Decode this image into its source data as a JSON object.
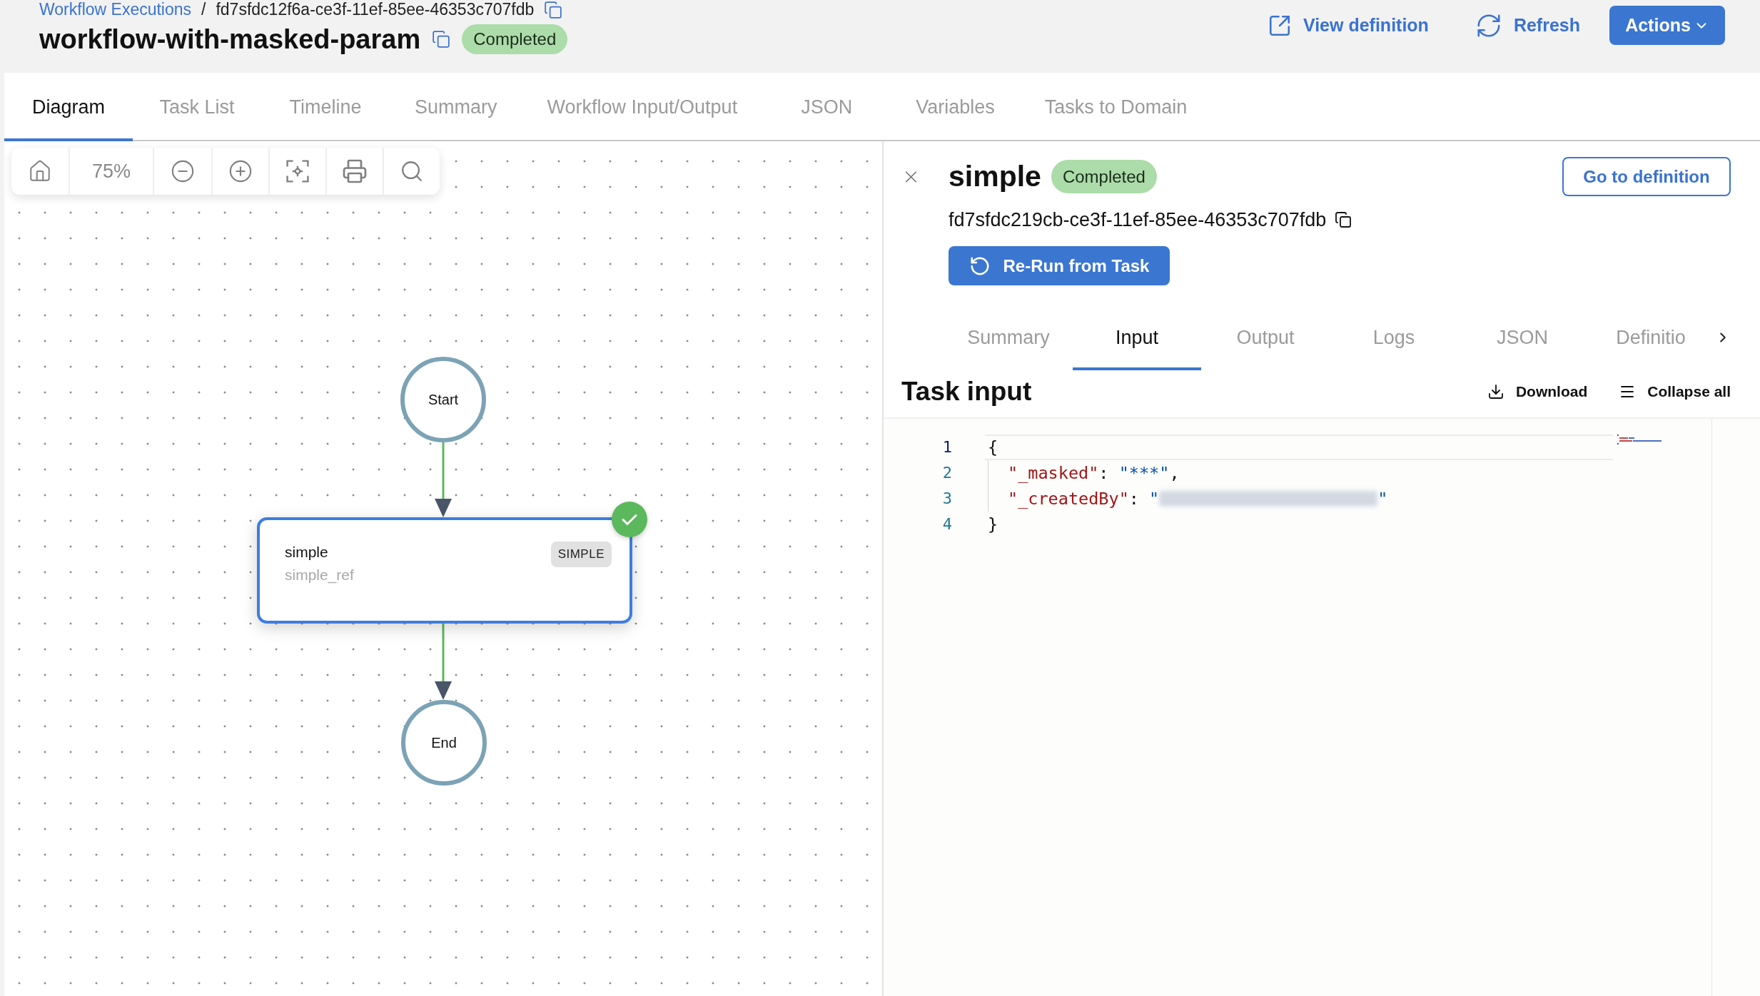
{
  "breadcrumb": {
    "link": "Workflow Executions",
    "separator": "/",
    "current": "fd7sfdc12f6a-ce3f-11ef-85ee-46353c707fdb"
  },
  "header": {
    "title": "workflow-with-masked-param",
    "status": "Completed",
    "view_definition": "View definition",
    "refresh": "Refresh",
    "actions": "Actions"
  },
  "tabs": [
    {
      "label": "Diagram",
      "selected": true
    },
    {
      "label": "Task List",
      "selected": false
    },
    {
      "label": "Timeline",
      "selected": false
    },
    {
      "label": "Summary",
      "selected": false
    },
    {
      "label": "Workflow Input/Output",
      "selected": false
    },
    {
      "label": "JSON",
      "selected": false
    },
    {
      "label": "Variables",
      "selected": false
    },
    {
      "label": "Tasks to Domain",
      "selected": false
    }
  ],
  "diagram": {
    "zoom": "75%",
    "nodes": [
      {
        "kind": "start",
        "label": "Start"
      },
      {
        "kind": "task",
        "name": "simple",
        "reference": "simple_ref",
        "type": "SIMPLE",
        "completed": true
      },
      {
        "kind": "end",
        "label": "End"
      }
    ],
    "edges": [
      {
        "executed": true
      },
      {
        "executed": true
      }
    ]
  },
  "task_panel": {
    "title": "simple",
    "status": "Completed",
    "go_to_definition": "Go to definition",
    "task_id": "fd7sfdc219cb-ce3f-11ef-85ee-46353c707fdb",
    "rerun": "Re-Run from Task",
    "tabs": [
      {
        "label": "Summary",
        "selected": false
      },
      {
        "label": "Input",
        "selected": true
      },
      {
        "label": "Output",
        "selected": false
      },
      {
        "label": "Logs",
        "selected": false
      },
      {
        "label": "JSON",
        "selected": false
      },
      {
        "label": "Definitio",
        "selected": false
      }
    ],
    "section_title": "Task input",
    "download": "Download",
    "collapse_all": "Collapse all",
    "code_lines": [
      {
        "number": "1",
        "active": true,
        "tokens": [
          {
            "kind": "punct",
            "text": "{"
          }
        ],
        "children": [
          {
            "number": "2",
            "active": false,
            "tokens": [
              {
                "kind": "key",
                "text": "\"_masked\""
              },
              {
                "kind": "punct",
                "text": ": "
              },
              {
                "kind": "string",
                "text": "\"***\""
              },
              {
                "kind": "punct",
                "text": ","
              }
            ]
          },
          {
            "number": "3",
            "active": false,
            "tokens": [
              {
                "kind": "key",
                "text": "\"_createdBy\""
              },
              {
                "kind": "punct",
                "text": ": "
              },
              {
                "kind": "string",
                "text": "\""
              },
              {
                "kind": "redacted"
              },
              {
                "kind": "string",
                "text": "\""
              }
            ]
          }
        ]
      },
      {
        "number": "4",
        "active": false,
        "tokens": [
          {
            "kind": "punct",
            "text": "}"
          }
        ]
      }
    ]
  }
}
